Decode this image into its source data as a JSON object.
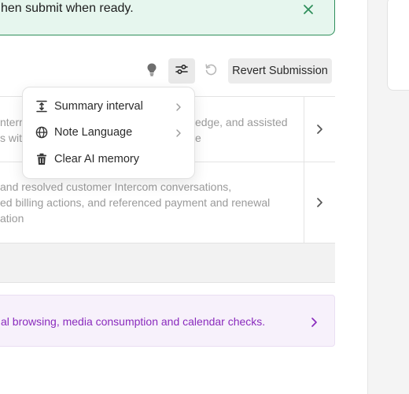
{
  "banner": {
    "text": "hen submit when ready.",
    "accent": "#2f8f5b",
    "background": "#e6f6ee"
  },
  "toolbar": {
    "bulb_icon": "lightbulb-icon",
    "filter_icon": "sliders-icon",
    "undo_icon": "undo-icon",
    "revert_label": "Revert Submission"
  },
  "menu": {
    "items": [
      {
        "label": "Summary interval",
        "icon": "vertical-interval-icon",
        "has_submenu": true
      },
      {
        "label": "Note Language",
        "icon": "globe-icon",
        "has_submenu": true
      },
      {
        "label": "Clear AI memory",
        "icon": "trash-icon",
        "has_submenu": false
      }
    ]
  },
  "rows": [
    {
      "lines": [
        "nterr",
        "s wit"
      ],
      "lines_right": [
        "edge, and assisted",
        "e"
      ]
    },
    {
      "lines": [
        "and resolved customer Intercom conversations,",
        "ed billing actions, and referenced payment and renewal",
        "ation"
      ]
    }
  ],
  "purple_card": {
    "text": "al browsing, media consumption and calendar checks.",
    "color": "#8a2bbd"
  }
}
